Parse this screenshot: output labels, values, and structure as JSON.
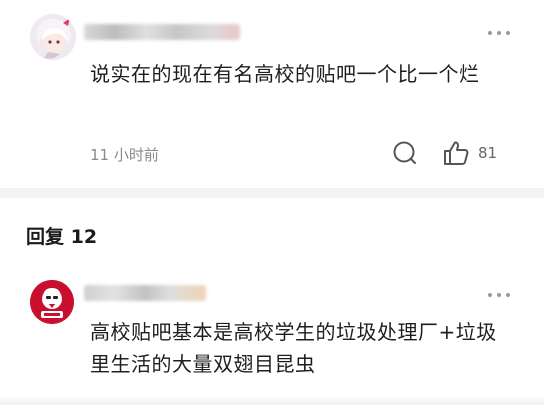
{
  "post": {
    "content": "说实在的现在有名高校的贴吧一个比一个烂",
    "time": "11 小时前",
    "like_count": "81"
  },
  "replies_header": "回复 12",
  "reply": {
    "content": "高校贴吧基本是高校学生的垃圾处理厂+垃圾里生活的大量双翅目昆虫"
  },
  "icons": {
    "more": "more-dots-icon",
    "comment": "comment-bubble-icon",
    "like": "thumbs-up-icon"
  },
  "colors": {
    "background": "#ffffff",
    "divider": "#f3f3f3",
    "meta_text": "#8a8a8a",
    "kfc_red": "#c8102e"
  }
}
